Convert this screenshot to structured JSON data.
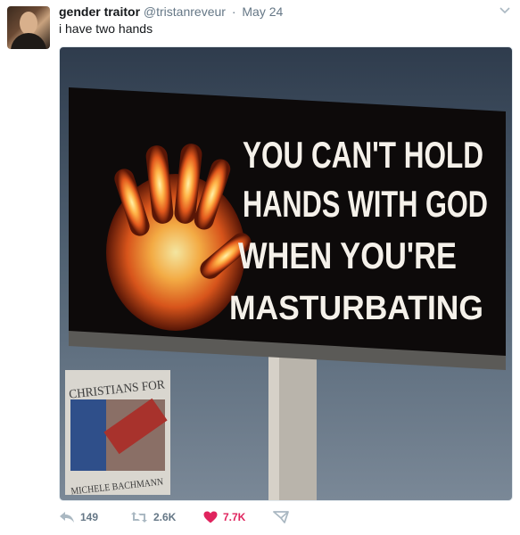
{
  "tweet": {
    "display_name": "gender traitor",
    "handle": "@tristanreveur",
    "separator": "·",
    "date": "May 24",
    "text": "i have two hands"
  },
  "media": {
    "billboard_lines": [
      "YOU CAN'T HOLD",
      "HANDS WITH GOD",
      "WHEN YOU'RE",
      "MASTURBATING"
    ],
    "sign_text_top": "CHRISTIANS FOR",
    "sign_text_bottom": "MICHELE BACHMANN"
  },
  "actions": {
    "reply_count": "149",
    "retweet_count": "2.6K",
    "like_count": "7.7K"
  },
  "colors": {
    "like": "#e0245e",
    "muted": "#657786"
  }
}
